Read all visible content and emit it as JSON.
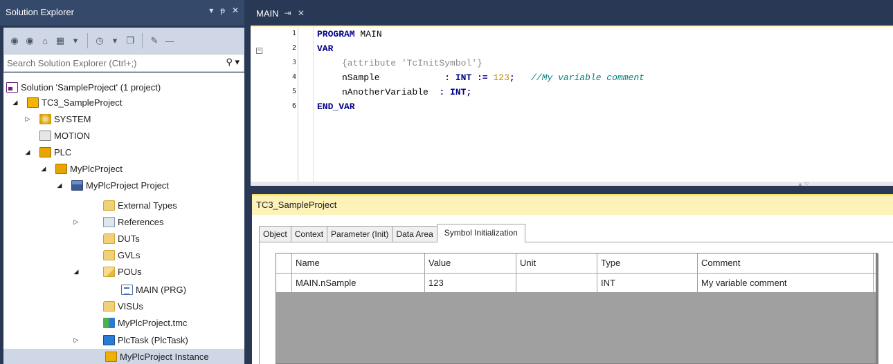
{
  "solution_explorer": {
    "title": "Solution Explorer",
    "title_buttons": [
      "▾",
      "ᵽ",
      "✕"
    ],
    "search_placeholder": "Search Solution Explorer (Ctrl+;)",
    "tree": [
      {
        "label": "Solution 'SampleProject' (1 project)",
        "icon": "solution-icon"
      },
      {
        "label": "TC3_SampleProject",
        "icon": "twincat-project-icon"
      },
      {
        "label": "SYSTEM",
        "icon": "system-icon"
      },
      {
        "label": "MOTION",
        "icon": "motion-icon"
      },
      {
        "label": "PLC",
        "icon": "plc-icon"
      },
      {
        "label": "MyPlcProject",
        "icon": "plc-project-icon"
      },
      {
        "label": "MyPlcProject Project",
        "icon": "project-icon"
      },
      {
        "label": "External Types",
        "icon": "folder-icon"
      },
      {
        "label": "References",
        "icon": "references-icon"
      },
      {
        "label": "DUTs",
        "icon": "folder-icon"
      },
      {
        "label": "GVLs",
        "icon": "folder-icon"
      },
      {
        "label": "POUs",
        "icon": "folder-open-icon"
      },
      {
        "label": "MAIN (PRG)",
        "icon": "program-icon"
      },
      {
        "label": "VISUs",
        "icon": "folder-icon"
      },
      {
        "label": "MyPlcProject.tmc",
        "icon": "tmc-icon"
      },
      {
        "label": "PlcTask (PlcTask)",
        "icon": "task-icon"
      },
      {
        "label": "MyPlcProject Instance",
        "icon": "instance-icon"
      }
    ]
  },
  "editor": {
    "tab_label": "MAIN",
    "tab_buttons": "⇥ ✕",
    "line_numbers": [
      "1",
      "2",
      "3",
      "4",
      "5",
      "6"
    ],
    "fold_marker": "−",
    "lines": {
      "l1_kw": "PROGRAM",
      "l1_name": " MAIN",
      "l2_kw": "VAR",
      "l3_attr": "{attribute 'TcInitSymbol'}",
      "l4_var": "nSample            ",
      "l4_colon": ": ",
      "l4_type": "INT",
      "l4_assign": " := ",
      "l4_value": "123",
      "l4_semi": ";   ",
      "l4_comment": "//My variable comment",
      "l5_var": "nAnotherVariable  ",
      "l5_colon": ": ",
      "l5_type": "INT",
      "l5_semi": ";",
      "l6_kw": "END_VAR"
    }
  },
  "lower_panel": {
    "title": "TC3_SampleProject",
    "tabs": [
      "Object",
      "Context",
      "Parameter (Init)",
      "Data Area",
      "Symbol Initialization"
    ],
    "active_tab": "Symbol Initialization",
    "columns": [
      "Name",
      "Value",
      "Unit",
      "Type",
      "Comment"
    ],
    "rows": [
      {
        "name": "MAIN.nSample",
        "value": "123",
        "unit": "",
        "type": "INT",
        "comment": "My variable comment"
      }
    ]
  }
}
